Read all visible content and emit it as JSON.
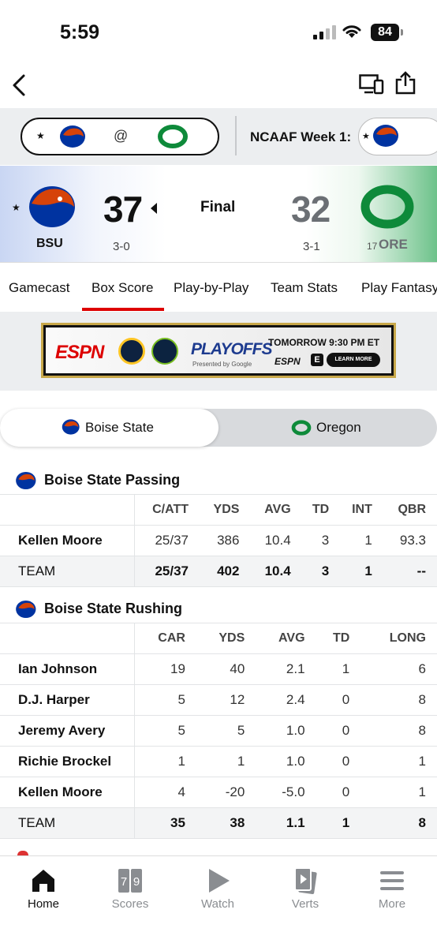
{
  "status_bar": {
    "time": "5:59",
    "battery": "84"
  },
  "strip": {
    "matchup_at": "@",
    "week_label": "NCAAF Week 1:"
  },
  "scoreboard": {
    "away": {
      "abbr": "BSU",
      "score": "37",
      "record": "3-0",
      "color": "#0033a0",
      "accent": "#d64309"
    },
    "home": {
      "abbr": "ORE",
      "rank": "17",
      "score": "32",
      "record": "3-1",
      "color": "#154733"
    },
    "status": "Final"
  },
  "tabs": [
    "Gamecast",
    "Box Score",
    "Play-by-Play",
    "Team Stats",
    "Play Fantasy"
  ],
  "active_tab": "Box Score",
  "ad": {
    "brand": "ESPN",
    "event": "PLAYOFFS",
    "presented": "Presented by Google",
    "time": "TOMORROW 9:30 PM ET",
    "network": "ESPN",
    "cta": "LEARN MORE"
  },
  "team_toggle": {
    "left": "Boise State",
    "right": "Oregon"
  },
  "passing": {
    "title": "Boise State Passing",
    "headers": [
      "C/ATT",
      "YDS",
      "AVG",
      "TD",
      "INT",
      "QBR"
    ],
    "rows": [
      {
        "name": "Kellen Moore",
        "vals": [
          "25/37",
          "386",
          "10.4",
          "3",
          "1",
          "93.3"
        ]
      }
    ],
    "team": {
      "name": "TEAM",
      "vals": [
        "25/37",
        "402",
        "10.4",
        "3",
        "1",
        "--"
      ]
    }
  },
  "rushing": {
    "title": "Boise State Rushing",
    "headers": [
      "CAR",
      "YDS",
      "AVG",
      "TD",
      "LONG"
    ],
    "rows": [
      {
        "name": "Ian Johnson",
        "vals": [
          "19",
          "40",
          "2.1",
          "1",
          "6"
        ]
      },
      {
        "name": "D.J. Harper",
        "vals": [
          "5",
          "12",
          "2.4",
          "0",
          "8"
        ]
      },
      {
        "name": "Jeremy Avery",
        "vals": [
          "5",
          "5",
          "1.0",
          "0",
          "8"
        ]
      },
      {
        "name": "Richie Brockel",
        "vals": [
          "1",
          "1",
          "1.0",
          "0",
          "1"
        ]
      },
      {
        "name": "Kellen Moore",
        "vals": [
          "4",
          "-20",
          "-5.0",
          "0",
          "1"
        ]
      }
    ],
    "team": {
      "name": "TEAM",
      "vals": [
        "35",
        "38",
        "1.1",
        "1",
        "8"
      ]
    }
  },
  "bottom_nav": [
    {
      "label": "Home",
      "icon": "home-icon",
      "active": true
    },
    {
      "label": "Scores",
      "icon": "scores-icon",
      "active": false
    },
    {
      "label": "Watch",
      "icon": "play-icon",
      "active": false
    },
    {
      "label": "Verts",
      "icon": "verts-icon",
      "active": false
    },
    {
      "label": "More",
      "icon": "menu-icon",
      "active": false
    }
  ]
}
